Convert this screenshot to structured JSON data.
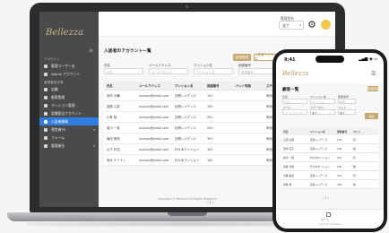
{
  "desktop": {
    "brand": "Bellezza",
    "sidebar": {
      "group_1": "アカウント",
      "items_1": [
        {
          "label": "管理ユーザー名",
          "caret": ""
        },
        {
          "label": "Admin アカウント",
          "caret": ""
        }
      ],
      "group_2": "管理者設定等",
      "items_2": [
        {
          "label": "店舗",
          "caret": ""
        },
        {
          "label": "顧客管理",
          "caret": ""
        },
        {
          "label": "マンション管理",
          "caret": ""
        },
        {
          "label": "設備割当アカウント",
          "caret": ""
        },
        {
          "label": "入居者情報",
          "caret": ""
        },
        {
          "label": "運営者TK",
          "caret": "▾"
        },
        {
          "label": "フォーム",
          "caret": ""
        },
        {
          "label": "管理者名",
          "caret": "▾"
        }
      ]
    },
    "topbar": {
      "label": "管理会社",
      "select_value": "全て"
    },
    "page": {
      "title": "入居者のアカウント一覧",
      "btn_primary": "新規登録",
      "btn_outline_1": "入居者アカウント一括登録",
      "btn_outline_2": "入居者アカウント一括ダウ"
    },
    "filters": [
      {
        "label": "氏名",
        "placeholder": "氏名"
      },
      {
        "label": "メールアドレス",
        "placeholder": "メールアドレス"
      },
      {
        "label": "マンション名",
        "placeholder": "マンション名"
      },
      {
        "label": "部屋番号",
        "placeholder": "部屋番号"
      },
      {
        "label": "ステータス",
        "placeholder": "全て"
      }
    ],
    "table": {
      "columns": [
        "氏名",
        "メールアドレス",
        "マンション名",
        "部屋番号",
        "ペット有無",
        "ステータス",
        ""
      ],
      "rows": [
        [
          "深作 大輔",
          "xxxxxx@gmail.com",
          "目黒レジデンス",
          "101",
          "",
          "有効",
          ""
        ],
        [
          "遠藤 心菜",
          "xxxxxx@gmail.com",
          "目黒レジデンス",
          "102",
          "",
          "有効",
          ""
        ],
        [
          "小林 翔",
          "xxxxxx@gmail.com",
          "目黒レジデンス",
          "201",
          "",
          "有効",
          ""
        ],
        [
          "香川 一真",
          "xxxxxx@gmail.com",
          "目黒レジデンス",
          "202",
          "",
          "有効",
          ""
        ],
        [
          "篠田 美咲",
          "xxxxxx@gmail.com",
          "目黒レジデンス",
          "301",
          "",
          "有効",
          ""
        ],
        [
          "山下 彩花",
          "xxxxxx@gmail.com",
          "代々木マンション",
          "101",
          "",
          "有効",
          ""
        ],
        [
          "清水 ケイティ",
          "xxxxxx@gmail.com",
          "代々木マンション",
          "102",
          "",
          "有効",
          ""
        ]
      ]
    },
    "pager": "‹ 1 ›",
    "copyright": "Copyright © Bellezza All Rights Reserved."
  },
  "mobile": {
    "time": "9:41",
    "signal": "▂▄▆ ◉ ▭",
    "brand": "Bellezza",
    "title": "顧客一覧",
    "new_button": "新規登録",
    "filters": [
      {
        "label": "氏名",
        "placeholder": "氏名"
      },
      {
        "label": "マンション名",
        "placeholder": "マンション"
      },
      {
        "label": "部屋番号",
        "placeholder": "部屋"
      },
      {
        "label": "メール",
        "placeholder": "メールアドレス"
      },
      {
        "label": "ステータス",
        "placeholder": "全て"
      },
      {
        "label": "ペット",
        "placeholder": "全て"
      }
    ],
    "search_button": "検索",
    "table": {
      "columns": [
        "氏名",
        "マンション名",
        "部屋番号",
        "ペット",
        ""
      ],
      "rows": [
        [
          "山田 太郎",
          "目黒レジデンス",
          "101",
          "有",
          ""
        ],
        [
          "田中 花子",
          "目黒レジデンス",
          "102",
          "無",
          ""
        ],
        [
          "鈴木 一郎",
          "代々木マンション",
          "201",
          "有",
          ""
        ],
        [
          "佐藤 次郎",
          "代々木マンション",
          "202",
          "無",
          ""
        ],
        [
          "高橋 美香",
          "目黒レジデンス",
          "301",
          "有",
          ""
        ],
        [
          "伊藤 健",
          "目黒レジデンス",
          "302",
          "無",
          ""
        ]
      ]
    },
    "pager": "‹ 1 ›",
    "footer_label": "ホーム",
    "copyright": "Copyright © Bellezza"
  }
}
